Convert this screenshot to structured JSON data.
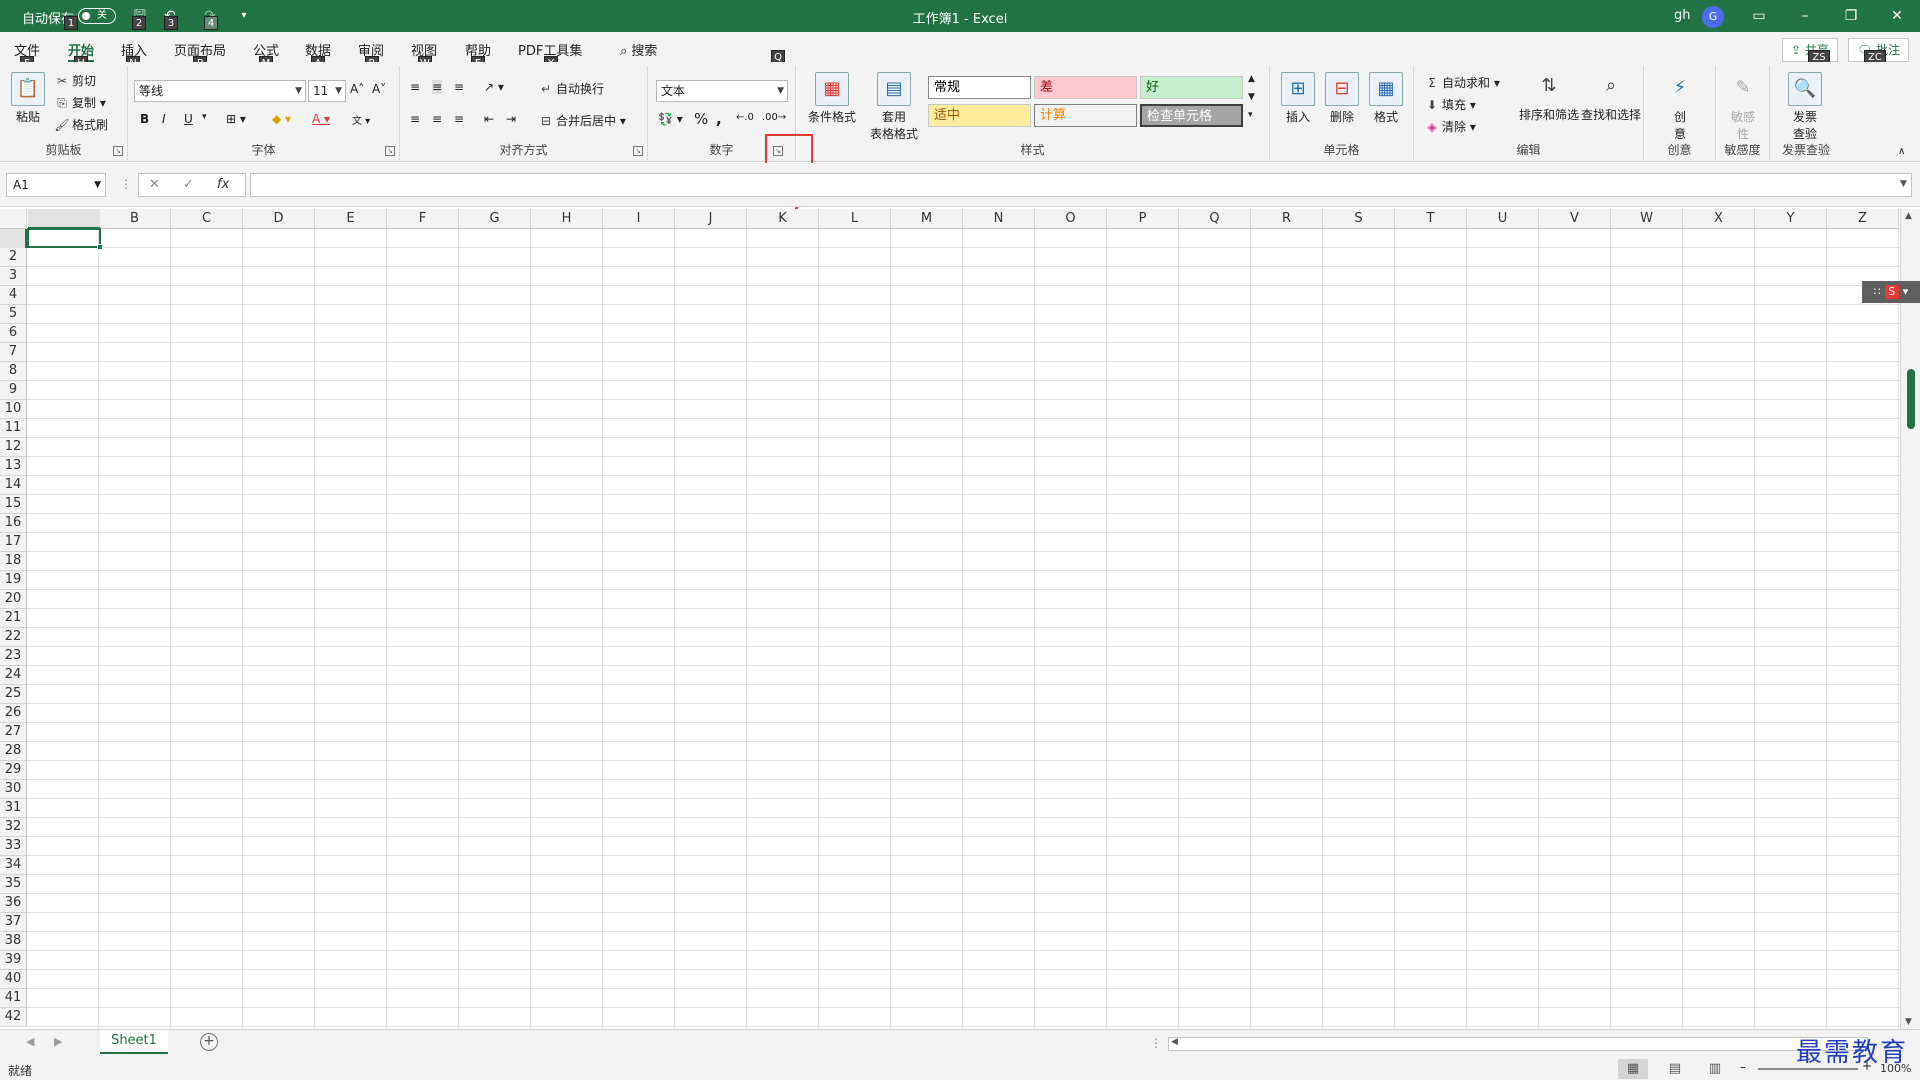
{
  "titlebar": {
    "autosave_label": "自动保存",
    "autosave_state": "关",
    "doc_title": "工作簿1  -  Excel",
    "user": "gh",
    "avatar_letter": "G",
    "keytips": [
      "1",
      "2",
      "3",
      "4"
    ]
  },
  "tabs": [
    {
      "label": "文件",
      "key": "F"
    },
    {
      "label": "开始",
      "key": "H"
    },
    {
      "label": "插入",
      "key": "N"
    },
    {
      "label": "页面布局",
      "key": "P"
    },
    {
      "label": "公式",
      "key": "M"
    },
    {
      "label": "数据",
      "key": "A"
    },
    {
      "label": "审阅",
      "key": "R"
    },
    {
      "label": "视图",
      "key": "W"
    },
    {
      "label": "帮助",
      "key": "E"
    },
    {
      "label": "PDF工具集",
      "key": "Y"
    }
  ],
  "search": {
    "label": "搜索",
    "key": "Q"
  },
  "share": {
    "label": "共享",
    "key": "ZS"
  },
  "comment": {
    "label": "批注",
    "key": "ZC"
  },
  "clipboard": {
    "paste": "粘贴",
    "cut": "剪切",
    "copy": "复制",
    "format_painter": "格式刷",
    "group": "剪贴板"
  },
  "font": {
    "name": "等线",
    "size": "11",
    "group": "字体",
    "bold": "B",
    "italic": "I",
    "underline": "U"
  },
  "alignment": {
    "wrap": "自动换行",
    "merge": "合并后居中",
    "group": "对齐方式"
  },
  "number": {
    "format": "文本",
    "group": "数字"
  },
  "styles": {
    "conditional": "条件格式",
    "table_format_1": "套用",
    "table_format_2": "表格格式",
    "cells": [
      {
        "label": "常规",
        "bg": "#ffffff",
        "fg": "#000000"
      },
      {
        "label": "差",
        "bg": "#ffc7ce",
        "fg": "#9c0006"
      },
      {
        "label": "好",
        "bg": "#c6efce",
        "fg": "#006100"
      },
      {
        "label": "适中",
        "bg": "#ffeb9c",
        "fg": "#9c5700"
      },
      {
        "label": "计算",
        "bg": "#f2f2f2",
        "fg": "#fa7d00"
      },
      {
        "label": "检查单元格",
        "bg": "#a5a5a5",
        "fg": "#ffffff"
      }
    ],
    "group": "样式"
  },
  "cells": {
    "insert": "插入",
    "delete": "删除",
    "format": "格式",
    "group": "单元格"
  },
  "editing": {
    "autosum": "自动求和",
    "fill": "填充",
    "clear": "清除",
    "sort": "排序和筛选",
    "find": "查找和选择",
    "group": "编辑"
  },
  "ideas": {
    "label_1": "创",
    "label_2": "意",
    "group": "创意"
  },
  "sensitivity": {
    "label_1": "敏感",
    "label_2": "性",
    "group": "敏感度"
  },
  "invoice": {
    "label_1": "发票",
    "label_2": "查验",
    "group": "发票查验"
  },
  "formula_bar": {
    "name_box": "A1",
    "fx": "fx",
    "value": ""
  },
  "columns": [
    "A",
    "B",
    "C",
    "D",
    "E",
    "F",
    "G",
    "H",
    "I",
    "J",
    "K",
    "L",
    "M",
    "N",
    "O",
    "P",
    "Q",
    "R",
    "S",
    "T",
    "U",
    "V",
    "W",
    "X",
    "Y",
    "Z"
  ],
  "rows": [
    "1",
    "2",
    "3",
    "4",
    "5",
    "6",
    "7",
    "8",
    "9",
    "10",
    "11",
    "12",
    "13",
    "14",
    "15",
    "16",
    "17",
    "18",
    "19",
    "20",
    "21",
    "22",
    "23",
    "24",
    "25",
    "26",
    "27",
    "28",
    "29",
    "30",
    "31",
    "32",
    "33",
    "34",
    "35",
    "36",
    "37",
    "38",
    "39",
    "40",
    "41",
    "42"
  ],
  "sheets": [
    "Sheet1"
  ],
  "status": "就绪",
  "zoom": "100%",
  "watermark": "最需教育",
  "colors": {
    "accent": "#217346",
    "annotation": "#e53935"
  }
}
